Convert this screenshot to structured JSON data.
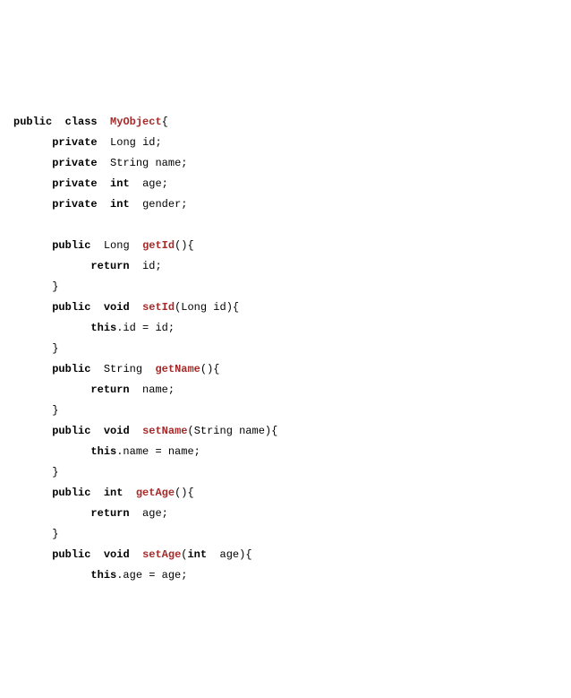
{
  "code": {
    "kw_public": "public",
    "kw_class": "class",
    "kw_private": "private",
    "kw_void": "void",
    "kw_int": "int",
    "kw_return": "return",
    "kw_this": "this",
    "type_long": "Long",
    "type_string": "String",
    "cls_name": "MyObject",
    "field_id": "id",
    "field_name": "name",
    "field_age": "age",
    "field_gender": "gender",
    "m_getId": "getId",
    "m_setId": "setId",
    "m_getName": "getName",
    "m_setName": "setName",
    "m_getAge": "getAge",
    "m_setAge": "setAge",
    "brace_open": "{",
    "brace_close": "}",
    "paren_open_close": "()",
    "paren_open": "(",
    "paren_close": ")",
    "semi": ";",
    "assign_id": ".id = id;",
    "assign_name": ".name = name;",
    "assign_age": ".age = age;",
    "sp": " "
  }
}
